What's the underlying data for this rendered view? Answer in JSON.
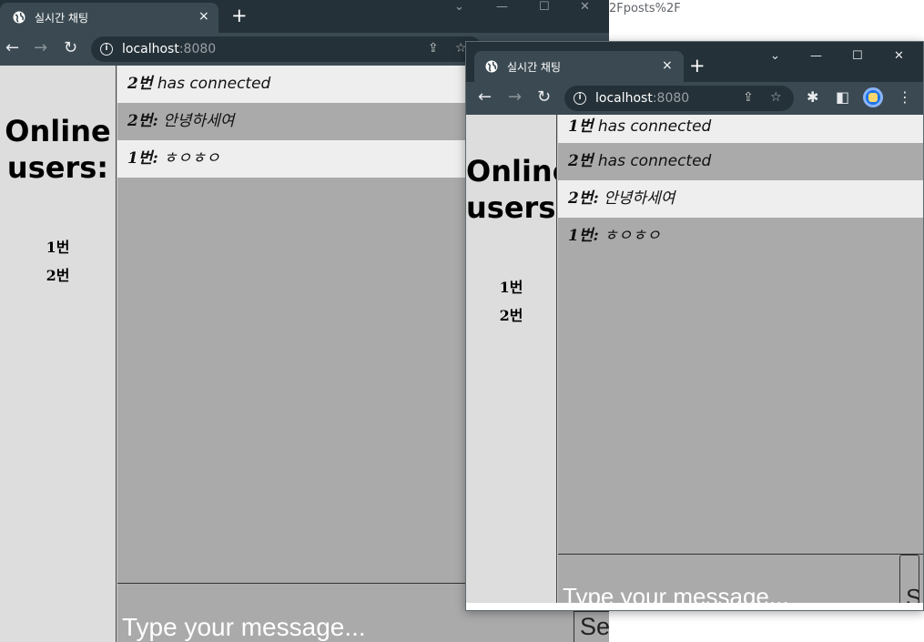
{
  "background": {
    "partial_url": "2Fposts%2F"
  },
  "browser": {
    "tab_title": "실시간 채팅",
    "tab_close": "×",
    "new_tab": "+",
    "url_host": "localhost",
    "url_port": ":8080",
    "window_controls": {
      "dropdown": "⌄",
      "minimize": "—",
      "maximize": "☐",
      "close": "✕"
    }
  },
  "chat": {
    "online_title_line1": "Online",
    "online_title_line2": "users:",
    "users": [
      "1번",
      "2번"
    ],
    "input_placeholder": "Type your message...",
    "send_label": "Send"
  },
  "window_back": {
    "messages": [
      {
        "user": "2번",
        "text": " has connected"
      },
      {
        "user": "2번:",
        "text": " 안녕하세여"
      },
      {
        "user": "1번:",
        "text": " ㅎㅇㅎㅇ"
      }
    ]
  },
  "window_front": {
    "messages": [
      {
        "user": "1번",
        "text": " has connected"
      },
      {
        "user": "2번",
        "text": " has connected"
      },
      {
        "user": "2번:",
        "text": " 안녕하세여"
      },
      {
        "user": "1번:",
        "text": " ㅎㅇㅎㅇ"
      }
    ]
  },
  "colors": {
    "tab_strip": "#243138",
    "toolbar": "#3b4a52",
    "sidebar": "#dddddd",
    "messages_bg": "#aaaaaa",
    "message_alt": "#eeeeee"
  }
}
